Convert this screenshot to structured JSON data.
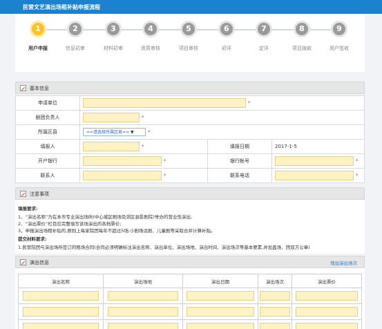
{
  "window": {
    "title": "民营文艺演出场租补贴申报流程"
  },
  "steps": [
    {
      "num": "1",
      "label": "用户申报"
    },
    {
      "num": "2",
      "label": "信息初审"
    },
    {
      "num": "3",
      "label": "材料初审"
    },
    {
      "num": "4",
      "label": "资质审核"
    },
    {
      "num": "5",
      "label": "项目审核"
    },
    {
      "num": "6",
      "label": "初评"
    },
    {
      "num": "7",
      "label": "定评"
    },
    {
      "num": "8",
      "label": "项目拨款"
    },
    {
      "num": "9",
      "label": "用户签收"
    }
  ],
  "basic_info": {
    "title": "基本信息",
    "applicant_label": "申请单位",
    "legal_person_label": "剧团负责人",
    "district_label": "所属区县",
    "district_value": "==请选择所属区县==",
    "filler_label": "填报人",
    "date_label": "填报日期",
    "date_value": "2017-1-5",
    "bank_label": "开户银行",
    "account_label": "银行帐号",
    "contact_label": "联系人",
    "phone_label": "联系电话",
    "required_mark": "*"
  },
  "notes": {
    "title": "注意事项",
    "fill_req_title": "填报要求:",
    "line1": "1、“演出名称”为在本市专业演出场所(中心城区剧场及郊区县影剧院)举办的营业性演出;",
    "line2": "2、“演出票价”栏目应完整填写该场演出的各档票价;",
    "line3": "3、申报演出场租补贴的,原则上每家院团每年不超过5场;小剧场话剧、儿童剧等采取合并计算补贴。",
    "materials_title": "提交材料要求:",
    "line4": "1.民营院团与演出场所签订的租场合同(合同必须明确标注演出名称、演出单位、演出场地、演出时间、演出场次等基本要素,并加盖场、团双方公章)"
  },
  "performance": {
    "title": "演出信息",
    "add_link": "增加演出场次",
    "columns": [
      "演出名称",
      "演出场地",
      "演出日期",
      "演出场次",
      "演出票价"
    ]
  }
}
